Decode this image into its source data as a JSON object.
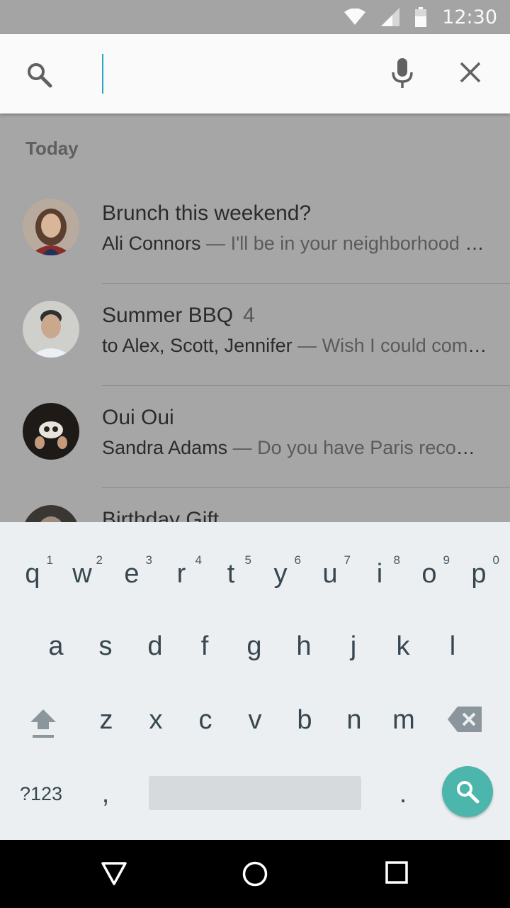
{
  "status_bar": {
    "time": "12:30",
    "icons": [
      "wifi-icon",
      "cell-signal-icon",
      "battery-icon"
    ]
  },
  "search": {
    "value": "",
    "placeholder": "",
    "icons": [
      "search-icon",
      "mic-icon",
      "close-icon"
    ],
    "cursor_color": "#2aa7c0"
  },
  "list": {
    "section": "Today",
    "items": [
      {
        "title": "Brunch this weekend?",
        "count": "",
        "sender": "Ali Connors",
        "snippet": " — I'll be in your neighborhood doing errands this weekend"
      },
      {
        "title": "Summer BBQ",
        "count": "4",
        "sender": "to Alex, Scott, Jennifer",
        "snippet": " — Wish I could come, but I'm out of town this weekend"
      },
      {
        "title": "Oui Oui",
        "count": "",
        "sender": "Sandra Adams",
        "snippet": " — Do you have Paris recommendations? Have you ever been?"
      },
      {
        "title": "Birthday Gift",
        "count": "",
        "sender": "",
        "snippet": ""
      }
    ]
  },
  "keyboard": {
    "row1": [
      "q",
      "w",
      "e",
      "r",
      "t",
      "y",
      "u",
      "i",
      "o",
      "p"
    ],
    "row1_hints": [
      "1",
      "2",
      "3",
      "4",
      "5",
      "6",
      "7",
      "8",
      "9",
      "0"
    ],
    "row2": [
      "a",
      "s",
      "d",
      "f",
      "g",
      "h",
      "j",
      "k",
      "l"
    ],
    "row3": [
      "z",
      "x",
      "c",
      "v",
      "b",
      "n",
      "m"
    ],
    "symbols": "?123",
    "comma": ",",
    "period": ".",
    "accent_color": "#4db6ac"
  },
  "nav_bar": {
    "icons": [
      "back-icon",
      "home-icon",
      "recents-icon"
    ]
  }
}
